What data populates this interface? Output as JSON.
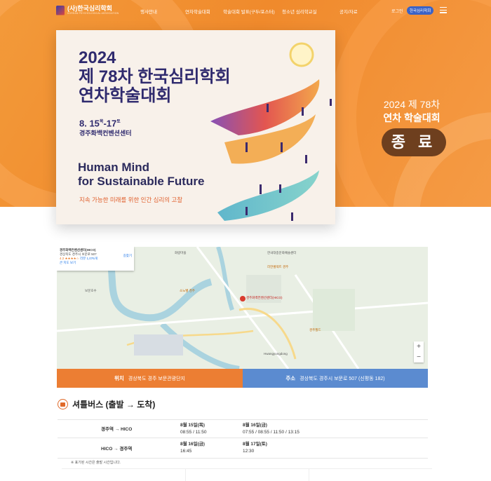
{
  "header": {
    "logo_text": "(사)한국심리학회",
    "logo_sub": "KOREAN PSYCHOLOGICAL ASSOCIATION",
    "menu": [
      "행사안내",
      "연차학술대회",
      "학술대회 발표(구두/포스터)",
      "청소년 심리학교실",
      "공지/자료"
    ],
    "login": "로그인",
    "join": "한국심리학회"
  },
  "poster": {
    "year": "2024",
    "title_line1": "제 78차 한국심리학회",
    "title_line2": "연차학술대회",
    "date": "8. 15",
    "date_day1": "목",
    "date_sep": "-17",
    "date_day2": "토",
    "venue": "경주화백컨벤션센터",
    "eng_line1": "Human Mind",
    "eng_line2": "for Sustainable Future",
    "subtitle": "지속 가능한 미래를 위한 인간 심리의 고찰"
  },
  "side": {
    "line1": "2024 제 78차",
    "line2": "연차 학술대회",
    "badge": "종 료"
  },
  "map": {
    "card_title": "경주화백컨벤션센터(HICO)",
    "card_addr": "경상북도 경주시 보문로 507",
    "card_rating": "4.2 ★★★★☆",
    "card_reviews": "리뷰 1,076개",
    "card_link": "큰 지도 보기",
    "card_dir": "길찾기",
    "marker_label": "경주화백컨벤션센터(HICO)",
    "labels": [
      "한국대중문화예술센터",
      "화랑마을",
      "라한셀렉트 경주",
      "소노벨 경주",
      "경주월드",
      "Hwangyongdong",
      "보문호수"
    ],
    "zoom_in": "+",
    "zoom_out": "−"
  },
  "location": {
    "label": "위치",
    "value": "경상북도 경주 보문관광단지"
  },
  "address": {
    "label": "주소",
    "value": "경상북도 경주시 보문로 507 (신평동 182)"
  },
  "shuttle": {
    "title": "셔틀버스 (출발 → 도착)",
    "rows": [
      {
        "route": "경주역 → HICO",
        "d1": "8월 15일(목)",
        "t1": "08:55 / 11:50",
        "d2": "8월 16일(금)",
        "t2": "07:55 / 08:55 / 11:50 / 13:15"
      },
      {
        "route": "HICO → 경주역",
        "d1": "8월 16일(금)",
        "t1": "16:45",
        "d2": "8월 17일(토)",
        "t2": "12:30"
      }
    ],
    "note": "※ 표기된 시간은 출발 시간입니다."
  },
  "colors": {
    "hero": "#f08a2c",
    "location_bar": "#ec7e33",
    "address_bar": "#5b8bd0",
    "badge": "#6e3f1e"
  }
}
